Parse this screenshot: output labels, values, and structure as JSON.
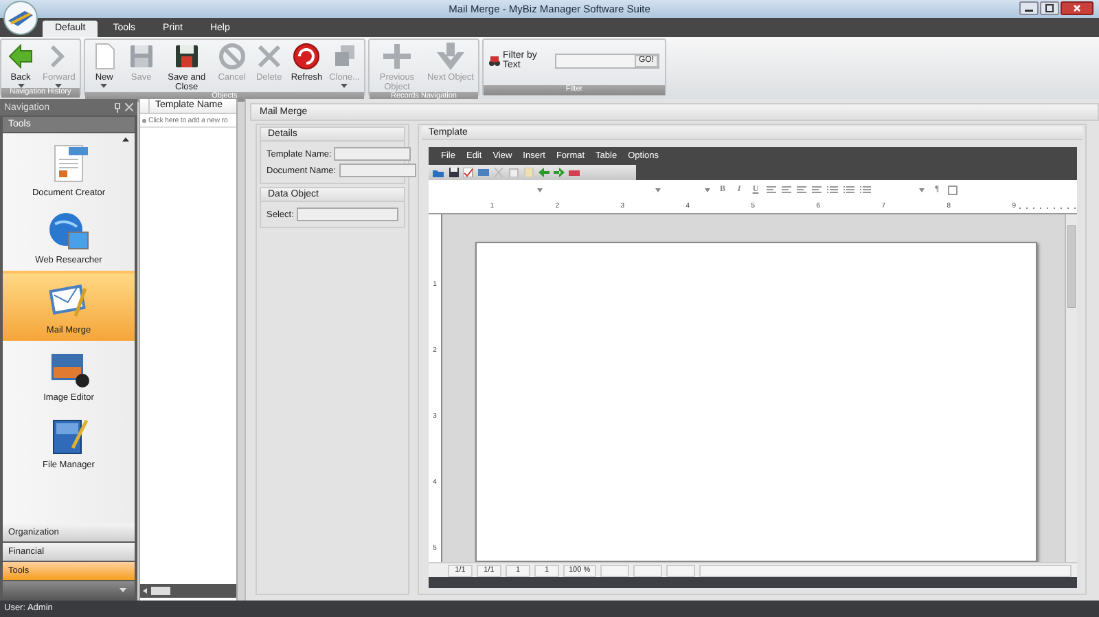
{
  "window": {
    "title": "Mail Merge - MyBiz Manager Software Suite"
  },
  "tabs": [
    {
      "label": "Default",
      "selected": true
    },
    {
      "label": "Tools",
      "selected": false
    },
    {
      "label": "Print",
      "selected": false
    },
    {
      "label": "Help",
      "selected": false
    }
  ],
  "ribbon": {
    "groups": [
      {
        "label": "Navigation History",
        "buttons": [
          {
            "label": "Back",
            "disabled": false,
            "dropdown": true
          },
          {
            "label": "Forward",
            "disabled": true,
            "dropdown": true
          }
        ]
      },
      {
        "label": "Objects",
        "buttons": [
          {
            "label": "New",
            "disabled": false,
            "dropdown": true
          },
          {
            "label": "Save",
            "disabled": true,
            "dropdown": false
          },
          {
            "label": "Save and Close",
            "disabled": false,
            "dropdown": false
          },
          {
            "label": "Cancel",
            "disabled": true,
            "dropdown": false
          },
          {
            "label": "Delete",
            "disabled": true,
            "dropdown": false
          },
          {
            "label": "Refresh",
            "disabled": false,
            "dropdown": false
          },
          {
            "label": "Clone...",
            "disabled": true,
            "dropdown": true
          }
        ]
      },
      {
        "label": "Records Navigation",
        "buttons": [
          {
            "label": "Previous Object",
            "disabled": true,
            "dropdown": false
          },
          {
            "label": "Next Object",
            "disabled": true,
            "dropdown": false
          }
        ]
      }
    ],
    "filter": {
      "group_label": "Filter",
      "label": "Filter by Text",
      "button": "GO!"
    }
  },
  "navigation": {
    "title": "Navigation",
    "section": "Tools",
    "items": [
      {
        "label": "Document Creator",
        "selected": false
      },
      {
        "label": "Web Researcher",
        "selected": false
      },
      {
        "label": "Mail Merge",
        "selected": true
      },
      {
        "label": "Image Editor",
        "selected": false
      },
      {
        "label": "File Manager",
        "selected": false
      }
    ],
    "panes": [
      {
        "label": "Organization",
        "selected": false
      },
      {
        "label": "Financial",
        "selected": false
      },
      {
        "label": "Tools",
        "selected": true
      }
    ]
  },
  "grid": {
    "columns": [
      "Template Name"
    ],
    "new_row": "Click here to add a new ro"
  },
  "mail_merge": {
    "title": "Mail Merge",
    "groups": [
      {
        "title": "Details",
        "fields": [
          "Template Name:",
          "Document Name:"
        ]
      },
      {
        "title": "Data Object",
        "fields": [
          "Select:"
        ]
      }
    ]
  },
  "template": {
    "title": "Template",
    "menus": [
      "File",
      "Edit",
      "View",
      "Insert",
      "Format",
      "Table",
      "Options"
    ],
    "format_buttons": [
      "B",
      "I",
      "U",
      "¶"
    ],
    "ruler": [
      "1",
      "2",
      "3",
      "4",
      "5",
      "6",
      "7",
      "8",
      "9"
    ],
    "vertical_ruler": [
      "1",
      "2",
      "3",
      "4",
      "5"
    ],
    "status_fields": [
      "1/1",
      "1/1",
      "1",
      "1",
      "100 %"
    ]
  },
  "status_bar": {
    "user": "User: Admin"
  }
}
